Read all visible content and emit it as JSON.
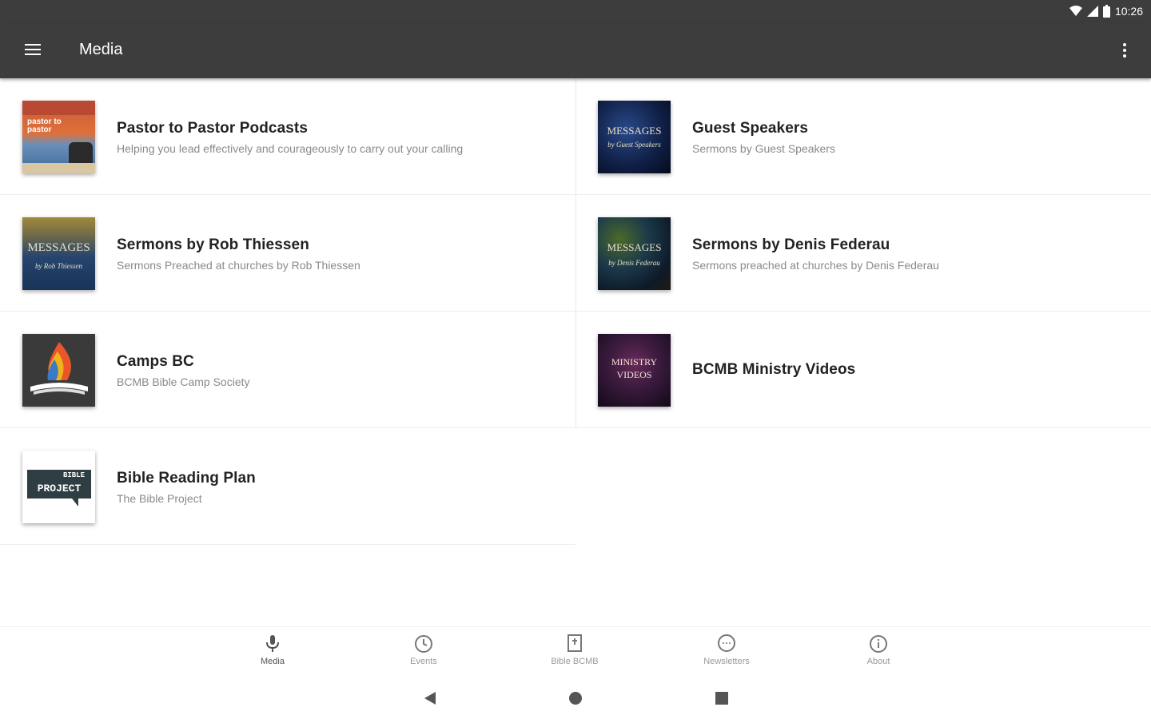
{
  "status_bar": {
    "time": "10:26"
  },
  "app_bar": {
    "title": "Media"
  },
  "cards": [
    {
      "title": "Pastor to Pastor Podcasts",
      "subtitle": "Helping you lead effectively and courageously to carry out your calling",
      "thumb_text": "pastor to pastor"
    },
    {
      "title": "Guest Speakers",
      "subtitle": "Sermons by Guest Speakers",
      "thumb_text": "MESSAGES",
      "thumb_sub": "by Guest Speakers"
    },
    {
      "title": "Sermons by Rob Thiessen",
      "subtitle": "Sermons Preached at churches by Rob Thiessen",
      "thumb_text": "MESSAGES",
      "thumb_sub": "by Rob Thiessen"
    },
    {
      "title": "Sermons by Denis Federau",
      "subtitle": "Sermons preached at churches by Denis Federau",
      "thumb_text": "MESSAGES",
      "thumb_sub": "by Denis Federau"
    },
    {
      "title": "Camps BC",
      "subtitle": "BCMB Bible Camp Society"
    },
    {
      "title": "BCMB Ministry Videos",
      "thumb_text": "MINISTRY",
      "thumb_sub": "VIDEOS"
    },
    {
      "title": "Bible Reading Plan",
      "subtitle": "The Bible Project",
      "thumb_text": "BIBLE",
      "thumb_sub": "PROJECT"
    }
  ],
  "bottom_nav": [
    {
      "label": "Media",
      "icon": "microphone-icon"
    },
    {
      "label": "Events",
      "icon": "clock-icon"
    },
    {
      "label": "Bible BCMB",
      "icon": "bible-icon"
    },
    {
      "label": "Newsletters",
      "icon": "chat-icon"
    },
    {
      "label": "About",
      "icon": "info-icon"
    }
  ],
  "colors": {
    "app_bar": "#3d3d3d",
    "background": "#ffffff",
    "title_text": "#222222",
    "subtitle_text": "#8a8a8a"
  }
}
